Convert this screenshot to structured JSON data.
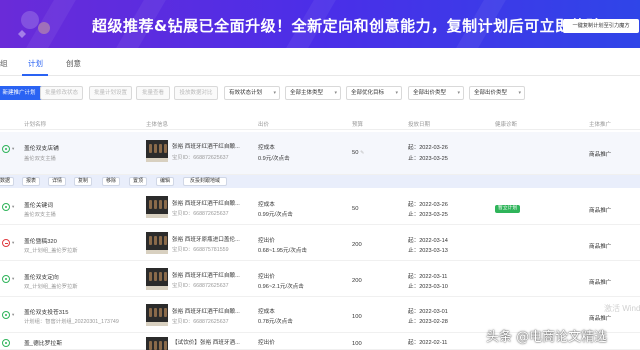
{
  "banner": {
    "headline": "超级推荐&钻展已全面升级！全新定向和创意能力，复制计划后可立即体验！",
    "button_label": "一键复制计划至引力魔方"
  },
  "tabs": [
    {
      "label": "组"
    },
    {
      "label": "计划"
    },
    {
      "label": "创意"
    }
  ],
  "toolbar": {
    "buttons": [
      {
        "label": "新建推广计划"
      },
      {
        "label": "批量修改状态"
      },
      {
        "label": "批量计划设置"
      },
      {
        "label": "批量查看"
      },
      {
        "label": "投放数据对比"
      }
    ],
    "selects": [
      {
        "label": "有效状态计划"
      },
      {
        "label": "全部主体类型"
      },
      {
        "label": "全部优化目标"
      },
      {
        "label": "全部出价类型"
      },
      {
        "label": "全部出价类型"
      }
    ]
  },
  "table": {
    "headers": [
      "计划名称",
      "主体信息",
      "出价",
      "预算",
      "投放日期",
      "健康诊断",
      "主体推广"
    ],
    "rows": [
      {
        "status": "on",
        "name": "盖伦双支店铺",
        "sub": "盖伦双支主播",
        "product_title": "张裕 西班牙红酒干红自酿...",
        "product_id": "宝贝ID：668872625637",
        "bid_line1": "控成本",
        "bid_line2": "0.9元/次点击",
        "budget": "50",
        "date_start": "起：2022-03-26",
        "date_end": "止：2023-03-25",
        "health": "",
        "promo_type": "商品推广"
      },
      {
        "status": "on",
        "name": "盖伦关键词",
        "sub": "盖伦双支主播",
        "product_title": "张裕 西班牙红酒干红自酿...",
        "product_id": "宝贝ID：668872625637",
        "bid_line1": "控成本",
        "bid_line2": "0.99元/次点击",
        "budget": "50",
        "date_start": "起：2022-03-26",
        "date_end": "止：2023-03-25",
        "health": "暂立计划",
        "promo_type": "商品推广"
      },
      {
        "status": "off",
        "name": "盖伦暨稿320",
        "sub": "双_计划组_盖伦罗拉斯",
        "product_title": "张裕 西班牙原瓶进口盖伦...",
        "product_id": "宝贝ID：668875781559",
        "bid_line1": "控出价",
        "bid_line2": "0.68~1.95元/次点击",
        "budget": "200",
        "date_start": "起：2022-03-14",
        "date_end": "止：2023-03-13",
        "health": "",
        "promo_type": "商品推广"
      },
      {
        "status": "on",
        "name": "盖伦双支定向",
        "sub": "双_计划组_盖伦罗拉斯",
        "product_title": "张裕 西班牙红酒干红自酿...",
        "product_id": "宝贝ID：668872625637",
        "bid_line1": "控出价",
        "bid_line2": "0.96~2.1元/次点击",
        "budget": "200",
        "date_start": "起：2022-03-11",
        "date_end": "止：2023-03-10",
        "health": "",
        "promo_type": "商品推广"
      },
      {
        "status": "on",
        "name": "盖伦双支投苍315",
        "sub": "计划组：智窖计划组_20220301_173749",
        "product_title": "张裕 西班牙红酒干红自酿...",
        "product_id": "宝贝ID：668872625637",
        "bid_line1": "控成本",
        "bid_line2": "0.78元/次点击",
        "budget": "100",
        "date_start": "起：2022-03-01",
        "date_end": "止：2023-02-28",
        "health": "",
        "promo_type": "商品推广"
      },
      {
        "status": "on",
        "name": "盖_德比罗拉斯",
        "sub": "",
        "product_title": "【试饮价】张裕 西班牙酒...",
        "product_id": "",
        "bid_line1": "控出价",
        "bid_line2": "",
        "budget": "100",
        "date_start": "起：2022-02-11",
        "date_end": "",
        "health": "",
        "promo_type": "商品推广"
      }
    ]
  },
  "action_bar": {
    "items": [
      "数据",
      "报表",
      "详情",
      "复制",
      "移除",
      "置顶",
      "编辑",
      "反投封跟地域"
    ]
  },
  "watermarks": {
    "windows": "激活 Windows",
    "toutiao": "头条 @电商论文精选"
  }
}
